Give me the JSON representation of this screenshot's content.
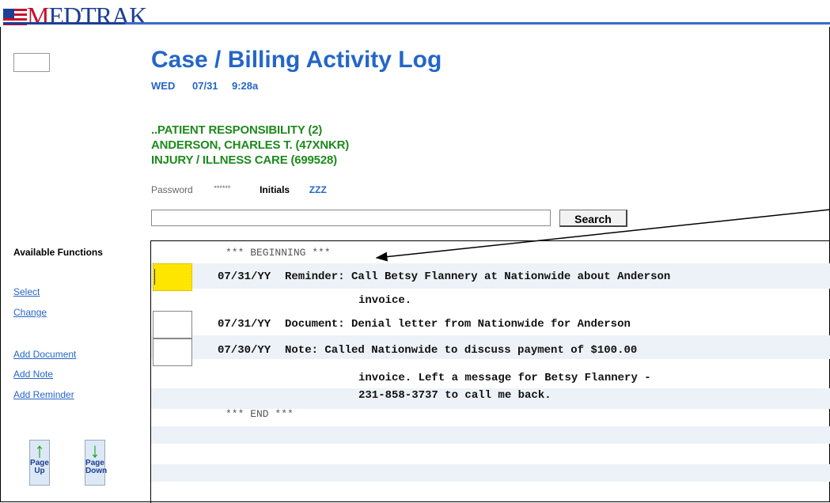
{
  "app": {
    "logo_text_red": "M",
    "logo_text_blue": "EDTRAK"
  },
  "header": {
    "title": "Case / Billing Activity Log",
    "day": "WED",
    "date": "07/31",
    "time": "9:28a"
  },
  "case": {
    "line1": "..PATIENT RESPONSIBILITY (2)",
    "line2": "ANDERSON, CHARLES T. (47XNKR)",
    "line3": "INJURY / ILLNESS CARE (699528)"
  },
  "auth": {
    "password_label": "Password",
    "password_mask": "******",
    "initials_label": "Initials",
    "initials_value": "ZZZ"
  },
  "search": {
    "value": "",
    "button_label": "Search"
  },
  "sidebar": {
    "heading": "Available Functions",
    "links": [
      "Select",
      "Change",
      "Add Document",
      "Add Note",
      "Add Reminder"
    ],
    "page_up": "Page Up",
    "page_down": "Page Down"
  },
  "log": {
    "begin_marker": "*** BEGINNING ***",
    "end_marker": "*** END ***",
    "entries": [
      {
        "date": "07/31/YY",
        "text": "Reminder:  Call Betsy Flannery at Nationwide about Anderson",
        "cont": [
          "invoice."
        ]
      },
      {
        "date": "07/31/YY",
        "text": "Document:  Denial letter from Nationwide for Anderson",
        "cont": []
      },
      {
        "date": "07/30/YY",
        "text": "Note:  Called Nationwide to discuss payment of $100.00",
        "cont": [
          "invoice.  Left a message for Betsy Flannery -",
          "231-858-3737 to call me back."
        ]
      }
    ]
  },
  "colors": {
    "title_blue": "#2466c9",
    "case_green": "#1e8a1e",
    "row_stripe": "#edf2f8",
    "selected_yellow": "#ffe600"
  }
}
